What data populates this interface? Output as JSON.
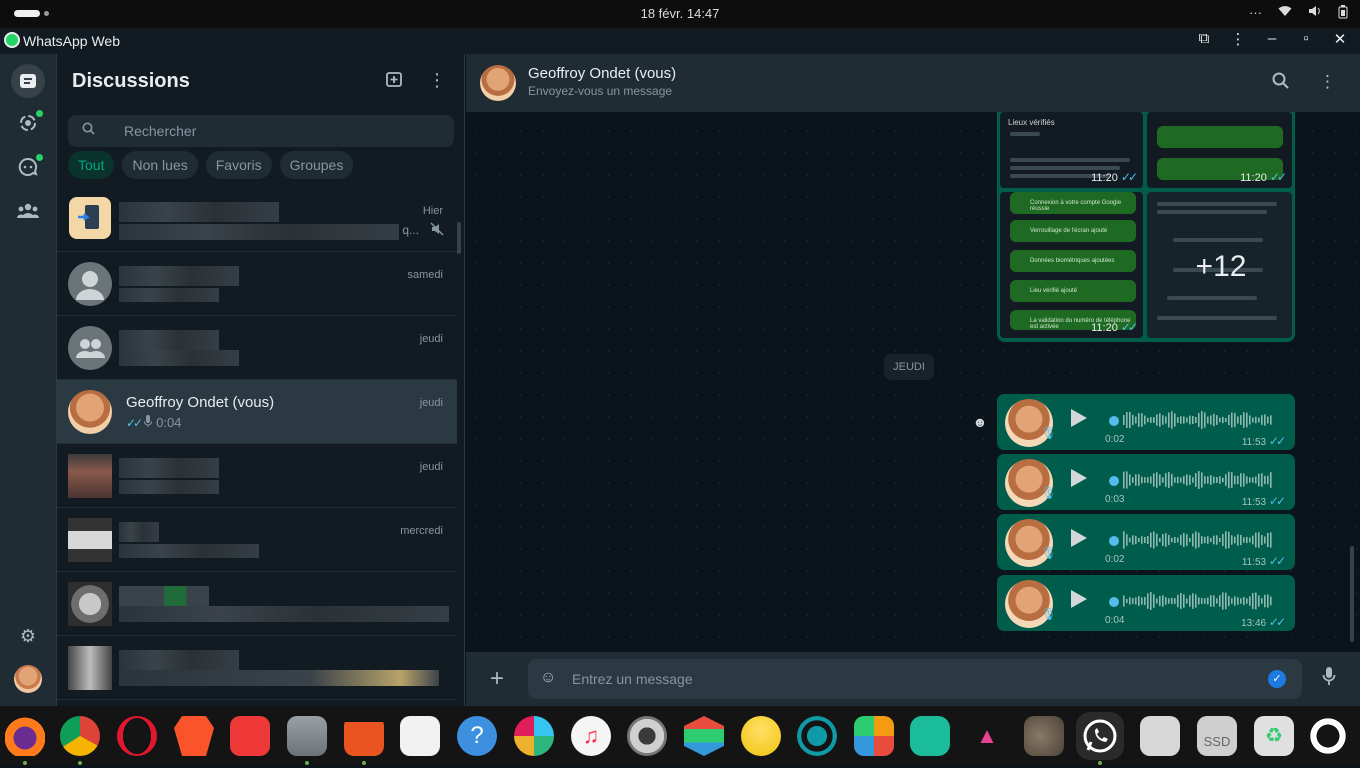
{
  "system": {
    "datetime": "18 févr.  14:47",
    "menu": "···",
    "status_icons": [
      "wifi-icon",
      "volume-icon",
      "battery-icon"
    ]
  },
  "window": {
    "title": "WhatsApp Web"
  },
  "sidebar": {
    "title": "Discussions",
    "search_placeholder": "Rechercher",
    "filters": [
      "Tout",
      "Non lues",
      "Favoris",
      "Groupes"
    ],
    "active_filter": "Tout",
    "chats": [
      {
        "time": "Hier",
        "preview_suffix": "q..."
      },
      {
        "time": "samedi"
      },
      {
        "time": "jeudi"
      },
      {
        "name": "Geoffroy Ondet (vous)",
        "time": "jeudi",
        "preview": "0:04"
      },
      {
        "time": "jeudi"
      },
      {
        "time": "mercredi"
      },
      {
        "time": ""
      },
      {
        "time": ""
      }
    ]
  },
  "conversation": {
    "contact": "Geoffroy Ondet (vous)",
    "subtitle": "Envoyez-vous un message",
    "album": {
      "more_count": "+12",
      "tiles": [
        {
          "time": "11:20",
          "title": "Lieux vérifiés"
        },
        {
          "time": "11:20"
        },
        {
          "time": "11:20"
        }
      ],
      "green_items": [
        "Connexion à votre compte Google réussie",
        "Verrouillage de l'écran ajouté",
        "Données biométriques ajoutées",
        "Lieu vérifié ajouté",
        "La validation du numéro de téléphone est activée"
      ]
    },
    "day_separator": "JEUDI",
    "voice_messages": [
      {
        "duration": "0:02",
        "time": "11:53"
      },
      {
        "duration": "0:03",
        "time": "11:53"
      },
      {
        "duration": "0:02",
        "time": "11:53"
      },
      {
        "duration": "0:04",
        "time": "13:46"
      }
    ],
    "composer_placeholder": "Entrez un message"
  },
  "colors": {
    "accent": "#00a884",
    "bubble_out": "#005c4b",
    "read_ticks": "#53bdeb",
    "background": "#0b141a"
  }
}
